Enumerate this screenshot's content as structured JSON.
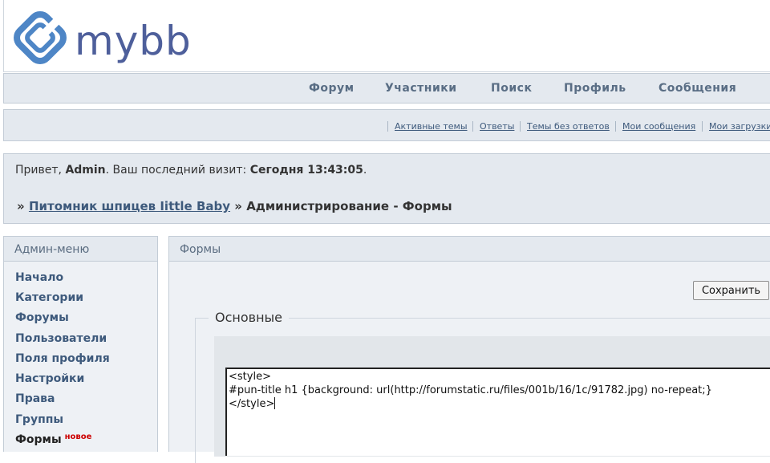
{
  "header": {
    "logo_text": "mybb",
    "brand_color": "#4e5f9b"
  },
  "main_nav": {
    "items": [
      {
        "label": "Форум"
      },
      {
        "label": "Участники"
      },
      {
        "label": "Поиск"
      },
      {
        "label": "Профиль"
      },
      {
        "label": "Сообщения"
      }
    ]
  },
  "sub_nav": {
    "items": [
      {
        "label": "Активные темы"
      },
      {
        "label": "Ответы"
      },
      {
        "label": "Темы без ответов"
      },
      {
        "label": "Мои сообщения"
      },
      {
        "label": "Мои загрузки"
      }
    ]
  },
  "welcome": {
    "greeting": "Привет, ",
    "username": "Admin",
    "last_visit_label": ".  Ваш последний визит: ",
    "last_visit_value": "Сегодня 13:43:05",
    "end": "."
  },
  "breadcrumb": {
    "separator": "»",
    "forum_link": "Питомник шпицев Iittle Baby",
    "current": "Администрирование - Формы"
  },
  "sidebar": {
    "title": "Админ-меню",
    "items": [
      {
        "label": "Начало"
      },
      {
        "label": "Категории"
      },
      {
        "label": "Форумы"
      },
      {
        "label": "Пользователи"
      },
      {
        "label": "Поля профиля"
      },
      {
        "label": "Настройки"
      },
      {
        "label": "Права"
      },
      {
        "label": "Группы"
      },
      {
        "label": "Формы",
        "badge": "новое"
      }
    ]
  },
  "content": {
    "title": "Формы",
    "save_label": "Сохранить",
    "section_label": "Основные",
    "editor_text": "<style>\n#pun-title h1 {background: url(http://forumstatic.ru/files/001b/16/1c/91782.jpg) no-repeat;}\n</style>"
  }
}
